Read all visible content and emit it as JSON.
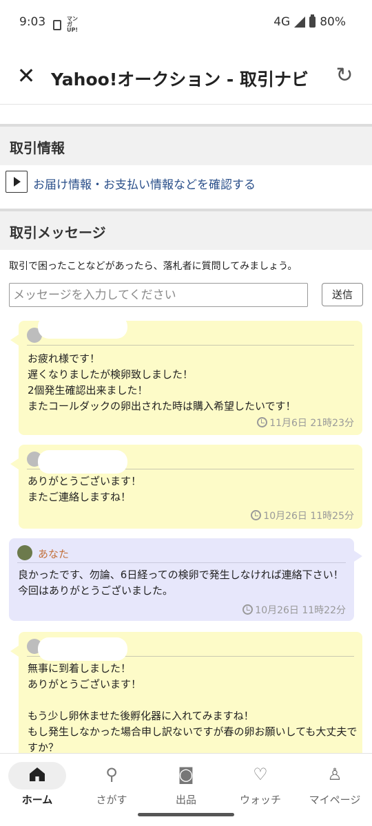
{
  "status_bar": {
    "time": "9:03",
    "manga_label": "マンガUP!",
    "network": "4G",
    "battery": "80%"
  },
  "app_bar": {
    "title": "Yahoo!オークション - 取引ナビ"
  },
  "sections": {
    "deal_info": "取引情報",
    "deal_info_link": "お届け情報・お支払い情報などを確認する",
    "messages": "取引メッセージ"
  },
  "compose": {
    "intro": "取引で困ったことなどがあったら、落札者に質問してみましょう。",
    "placeholder": "メッセージを入力してください",
    "send_label": "送信"
  },
  "messages": [
    {
      "author": "",
      "text": "お疲れ様です！\n遅くなりましたが検卵致しました！\n2個発生確認出来ました！\nまたコールダックの卵出された時は購入希望したいです！",
      "time": "11月6日 21時23分"
    },
    {
      "author": "",
      "text": "ありがとうございます！\nまたご連絡しますね！",
      "time": "10月26日 11時25分"
    },
    {
      "author": "あなた",
      "text": "良かったです、勿論、6日経っての検卵で発生しなければ連絡下さい！今回はありがとうございました。",
      "time": "10月26日 11時22分"
    },
    {
      "author": "",
      "text": "無事に到着しました！\nありがとうございます！\n\nもう少し卵休ませた後孵化器に入れてみますね！\nもし発生しなかった場合申し訳ないですが春の卵お願いしても大丈夫ですか？",
      "time": ""
    }
  ],
  "bottom_nav": [
    {
      "label": "ホーム",
      "icon": "home-icon"
    },
    {
      "label": "さがす",
      "icon": "search-icon"
    },
    {
      "label": "出品",
      "icon": "camera-icon"
    },
    {
      "label": "ウォッチ",
      "icon": "heart-icon"
    },
    {
      "label": "マイページ",
      "icon": "person-icon"
    }
  ]
}
